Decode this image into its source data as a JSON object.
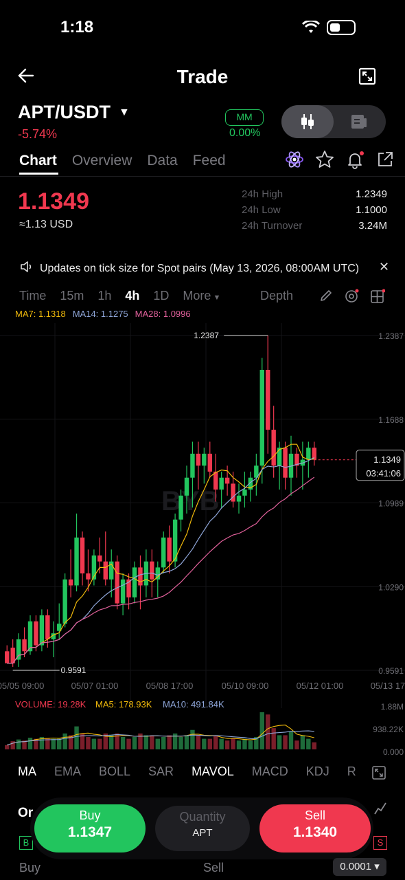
{
  "status": {
    "time": "1:18"
  },
  "header": {
    "title": "Trade"
  },
  "pair": {
    "symbol": "APT/USDT",
    "change": "-5.74%",
    "mm_label": "MM",
    "mm_value": "0.00%"
  },
  "tabs": [
    {
      "label": "Chart",
      "active": true
    },
    {
      "label": "Overview",
      "active": false
    },
    {
      "label": "Data",
      "active": false
    },
    {
      "label": "Feed",
      "active": false
    }
  ],
  "ticker": {
    "price": "1.1349",
    "usd": "≈1.13 USD",
    "stats": [
      {
        "label": "24h High",
        "value": "1.2349"
      },
      {
        "label": "24h Low",
        "value": "1.1000"
      },
      {
        "label": "24h Turnover",
        "value": "3.24M"
      }
    ]
  },
  "notice": {
    "text": "Updates on tick size for Spot pairs (May 13, 2026, 08:00AM UTC)"
  },
  "intervals": [
    "Time",
    "15m",
    "1h",
    "4h",
    "1D",
    "More"
  ],
  "active_interval": "4h",
  "depth_label": "Depth",
  "ma_legend": [
    {
      "label": "MA7: 1.1318",
      "color": "#f0b90b"
    },
    {
      "label": "MA14: 1.1275",
      "color": "#8fa6d9"
    },
    {
      "label": "MA28: 1.0996",
      "color": "#e0609a"
    }
  ],
  "chart_data": {
    "type": "candlestick",
    "watermark": "BYB",
    "price_axis": [
      "1.2387",
      "1.1688",
      "1.0989",
      "1.0290",
      "0.9591"
    ],
    "ylim": [
      0.9591,
      1.2387
    ],
    "x_labels": [
      "05/05 09:00",
      "05/07 01:00",
      "05/08 17:00",
      "05/10 09:00",
      "05/12 01:00",
      "05/13 17"
    ],
    "high_marker": "1.2387",
    "low_marker": "0.9591",
    "current_price": "1.1349",
    "countdown": "03:41:06",
    "candles": [
      [
        0.975,
        0.98,
        0.968,
        0.965
      ],
      [
        0.978,
        0.985,
        0.962,
        0.965
      ],
      [
        0.968,
        0.99,
        0.962,
        0.985
      ],
      [
        0.985,
        0.995,
        0.97,
        0.975
      ],
      [
        0.975,
        1.005,
        0.972,
        1.0
      ],
      [
        1.0,
        1.005,
        0.975,
        0.98
      ],
      [
        0.98,
        1.01,
        0.975,
        1.005
      ],
      [
        1.005,
        1.01,
        0.978,
        0.985
      ],
      [
        0.985,
        1.0,
        0.97,
        0.99
      ],
      [
        0.992,
        1.015,
        0.985,
        0.998
      ],
      [
        0.998,
        1.04,
        0.995,
        1.035
      ],
      [
        1.035,
        1.06,
        1.02,
        1.03
      ],
      [
        1.03,
        1.09,
        1.025,
        1.07
      ],
      [
        1.07,
        1.075,
        1.03,
        1.04
      ],
      [
        1.04,
        1.06,
        1.025,
        1.035
      ],
      [
        1.035,
        1.06,
        1.03,
        1.055
      ],
      [
        1.055,
        1.07,
        1.04,
        1.05
      ],
      [
        1.05,
        1.075,
        1.03,
        1.035
      ],
      [
        1.035,
        1.06,
        1.02,
        1.05
      ],
      [
        1.05,
        1.055,
        1.01,
        1.015
      ],
      [
        1.015,
        1.04,
        1.005,
        1.035
      ],
      [
        1.035,
        1.04,
        1.01,
        1.02
      ],
      [
        1.02,
        1.05,
        1.015,
        1.045
      ],
      [
        1.045,
        1.055,
        1.01,
        1.03
      ],
      [
        1.03,
        1.06,
        1.02,
        1.05
      ],
      [
        1.05,
        1.06,
        1.02,
        1.035
      ],
      [
        1.035,
        1.05,
        1.02,
        1.045
      ],
      [
        1.045,
        1.075,
        1.04,
        1.07
      ],
      [
        1.07,
        1.08,
        1.04,
        1.05
      ],
      [
        1.05,
        1.09,
        1.045,
        1.085
      ],
      [
        1.085,
        1.11,
        1.075,
        1.105
      ],
      [
        1.105,
        1.13,
        1.09,
        1.12
      ],
      [
        1.12,
        1.15,
        1.095,
        1.14
      ],
      [
        1.14,
        1.15,
        1.11,
        1.13
      ],
      [
        1.13,
        1.145,
        1.115,
        1.14
      ],
      [
        1.14,
        1.15,
        1.12,
        1.125
      ],
      [
        1.125,
        1.14,
        1.1,
        1.11
      ],
      [
        1.11,
        1.125,
        1.095,
        1.12
      ],
      [
        1.12,
        1.13,
        1.105,
        1.115
      ],
      [
        1.115,
        1.125,
        1.095,
        1.1
      ],
      [
        1.1,
        1.115,
        1.09,
        1.105
      ],
      [
        1.105,
        1.125,
        1.095,
        1.11
      ],
      [
        1.11,
        1.125,
        1.1,
        1.12
      ],
      [
        1.12,
        1.14,
        1.105,
        1.13
      ],
      [
        1.13,
        1.22,
        1.115,
        1.21
      ],
      [
        1.21,
        1.2387,
        1.14,
        1.16
      ],
      [
        1.16,
        1.18,
        1.12,
        1.13
      ],
      [
        1.13,
        1.15,
        1.11,
        1.145
      ],
      [
        1.145,
        1.15,
        1.11,
        1.12
      ],
      [
        1.12,
        1.155,
        1.105,
        1.14
      ],
      [
        1.14,
        1.145,
        1.12,
        1.13
      ],
      [
        1.13,
        1.15,
        1.11,
        1.135
      ],
      [
        1.135,
        1.15,
        1.12,
        1.145
      ],
      [
        1.145,
        1.15,
        1.13,
        1.135
      ]
    ],
    "volume": {
      "legend": {
        "volume": "VOLUME: 19.28K",
        "ma5": "MA5: 178.93K",
        "ma10": "MA10: 491.84K"
      },
      "axis": [
        "1.88M",
        "938.22K",
        "0.000"
      ]
    }
  },
  "indicators": [
    "MA",
    "EMA",
    "BOLL",
    "SAR",
    "MAVOL",
    "MACD",
    "KDJ",
    "R"
  ],
  "active_indicators": [
    "MA",
    "MAVOL"
  ],
  "trade": {
    "buy_label": "Buy",
    "buy_price": "1.1347",
    "qty_label": "Quantity",
    "qty_unit": "APT",
    "sell_label": "Sell",
    "sell_price": "1.1340",
    "order_tab": "Or",
    "bottom_buy": "Buy",
    "bottom_sell": "Sell",
    "tick_size": "0.0001 ▾",
    "b_mark": "B",
    "s_mark": "S"
  },
  "colors": {
    "up": "#22c55e",
    "down": "#f0384f",
    "ma7": "#f0b90b",
    "ma14": "#8fa6d9",
    "ma28": "#e0609a"
  }
}
